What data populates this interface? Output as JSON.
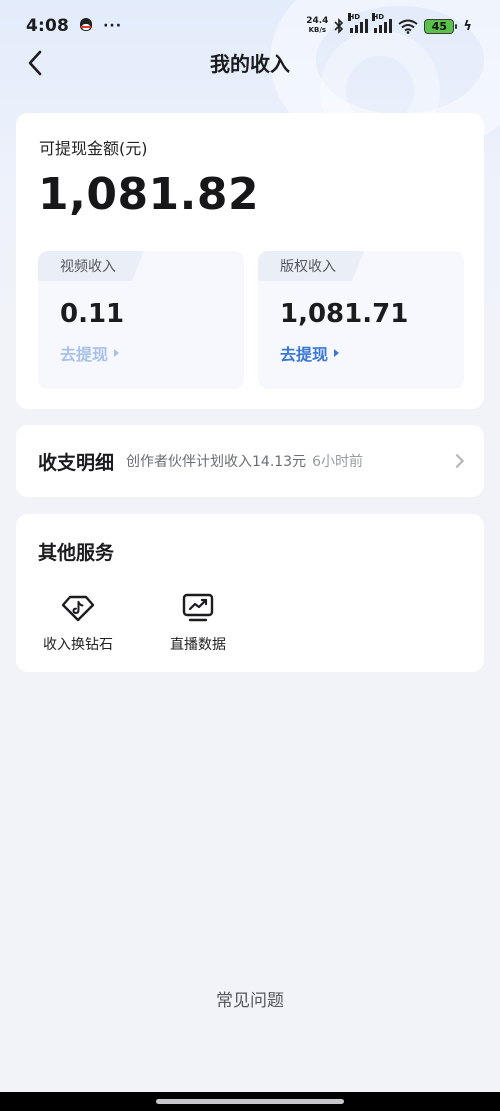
{
  "status_bar": {
    "time": "4:08",
    "more": "···",
    "net_speed_value": "24.4",
    "net_speed_unit": "KB/s",
    "signal_label": "HD",
    "battery": "45"
  },
  "header": {
    "title": "我的收入"
  },
  "balance": {
    "label": "可提现金额(元)",
    "amount": "1,081.82"
  },
  "income_cards": [
    {
      "tag": "视频收入",
      "amount": "0.11",
      "action": "去提现",
      "enabled": false
    },
    {
      "tag": "版权收入",
      "amount": "1,081.71",
      "action": "去提现",
      "enabled": true
    }
  ],
  "details": {
    "title": "收支明细",
    "latest": "创作者伙伴计划收入14.13元",
    "time": "6小时前"
  },
  "services": {
    "title": "其他服务",
    "items": [
      {
        "label": "收入换钻石",
        "icon": "diamond-icon"
      },
      {
        "label": "直播数据",
        "icon": "chart-monitor-icon"
      }
    ]
  },
  "faq": {
    "label": "常见问题"
  },
  "colors": {
    "accent": "#3b78d6",
    "accent_disabled": "#a8c1ea",
    "page_bg": "#f2f3f8"
  }
}
